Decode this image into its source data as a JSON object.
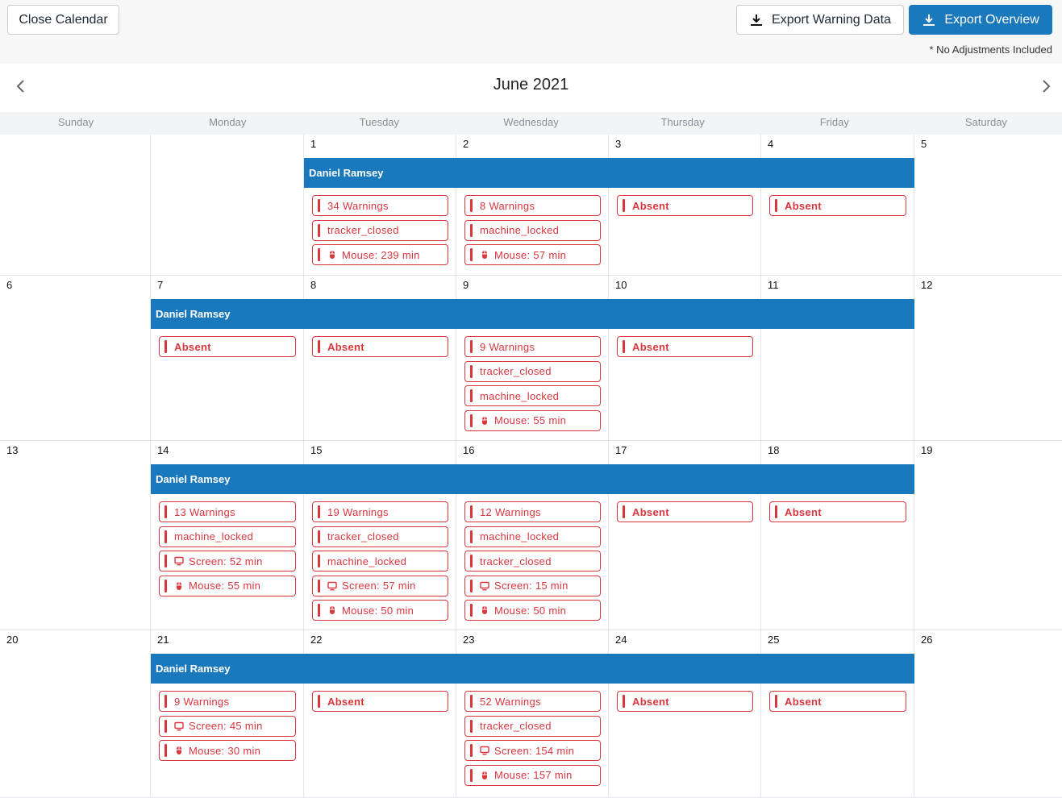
{
  "toolbar": {
    "close_label": "Close Calendar",
    "export_warning_label": "Export Warning Data",
    "export_overview_label": "Export Overview",
    "note": "* No Adjustments Included"
  },
  "calendar": {
    "title": "June 2021",
    "weekdays": [
      "Sunday",
      "Monday",
      "Tuesday",
      "Wednesday",
      "Thursday",
      "Friday",
      "Saturday"
    ],
    "employee": "Daniel Ramsey",
    "weeks": [
      {
        "days": [
          "",
          "",
          "1",
          "2",
          "3",
          "4",
          "5"
        ],
        "band_start": 2,
        "band_end": 5,
        "items": [
          [],
          [],
          [
            {
              "text": "34 Warnings"
            },
            {
              "text": "tracker_closed"
            },
            {
              "text": "Mouse: 239 min",
              "icon": "mouse"
            }
          ],
          [
            {
              "text": "8 Warnings"
            },
            {
              "text": "machine_locked"
            },
            {
              "text": "Mouse: 57 min",
              "icon": "mouse"
            }
          ],
          [
            {
              "text": "Absent",
              "bold": true
            }
          ],
          [
            {
              "text": "Absent",
              "bold": true
            }
          ],
          []
        ]
      },
      {
        "days": [
          "6",
          "7",
          "8",
          "9",
          "10",
          "11",
          "12"
        ],
        "band_start": 1,
        "band_end": 5,
        "items": [
          [],
          [
            {
              "text": "Absent",
              "bold": true
            }
          ],
          [
            {
              "text": "Absent",
              "bold": true
            }
          ],
          [
            {
              "text": "9 Warnings"
            },
            {
              "text": "tracker_closed"
            },
            {
              "text": "machine_locked"
            },
            {
              "text": "Mouse: 55 min",
              "icon": "mouse"
            }
          ],
          [
            {
              "text": "Absent",
              "bold": true
            }
          ],
          [],
          []
        ]
      },
      {
        "days": [
          "13",
          "14",
          "15",
          "16",
          "17",
          "18",
          "19"
        ],
        "band_start": 1,
        "band_end": 5,
        "items": [
          [],
          [
            {
              "text": "13 Warnings"
            },
            {
              "text": "machine_locked"
            },
            {
              "text": "Screen: 52 min",
              "icon": "screen"
            },
            {
              "text": "Mouse: 55 min",
              "icon": "mouse"
            }
          ],
          [
            {
              "text": "19 Warnings"
            },
            {
              "text": "tracker_closed"
            },
            {
              "text": "machine_locked"
            },
            {
              "text": "Screen: 57 min",
              "icon": "screen"
            },
            {
              "text": "Mouse: 50 min",
              "icon": "mouse"
            }
          ],
          [
            {
              "text": "12 Warnings"
            },
            {
              "text": "machine_locked"
            },
            {
              "text": "tracker_closed"
            },
            {
              "text": "Screen: 15 min",
              "icon": "screen"
            },
            {
              "text": "Mouse: 50 min",
              "icon": "mouse"
            }
          ],
          [
            {
              "text": "Absent",
              "bold": true
            }
          ],
          [
            {
              "text": "Absent",
              "bold": true
            }
          ],
          []
        ]
      },
      {
        "days": [
          "20",
          "21",
          "22",
          "23",
          "24",
          "25",
          "26"
        ],
        "band_start": 1,
        "band_end": 5,
        "items": [
          [],
          [
            {
              "text": "9 Warnings"
            },
            {
              "text": "Screen: 45 min",
              "icon": "screen"
            },
            {
              "text": "Mouse: 30 min",
              "icon": "mouse"
            }
          ],
          [
            {
              "text": "Absent",
              "bold": true
            }
          ],
          [
            {
              "text": "52 Warnings"
            },
            {
              "text": "tracker_closed"
            },
            {
              "text": "Screen: 154 min",
              "icon": "screen"
            },
            {
              "text": "Mouse: 157 min",
              "icon": "mouse"
            }
          ],
          [
            {
              "text": "Absent",
              "bold": true
            }
          ],
          [
            {
              "text": "Absent",
              "bold": true
            }
          ],
          []
        ]
      }
    ]
  },
  "colors": {
    "accent": "#1a78bd",
    "warning": "#d9363e"
  }
}
